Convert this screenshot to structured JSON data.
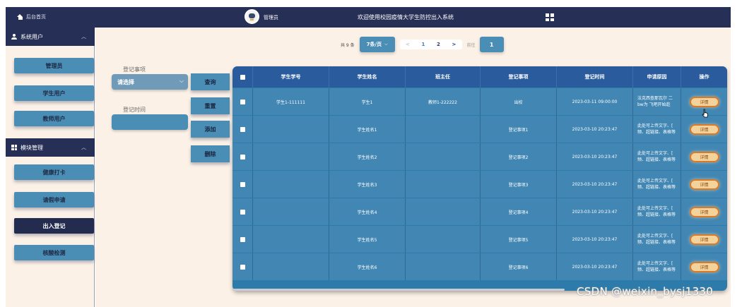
{
  "topbar": {
    "home_label": "后台首页",
    "role_label": "管理员",
    "title": "欢迎使用校园疫情大学生防控出入系统"
  },
  "sidebar": {
    "group1": {
      "label": "系统用户",
      "items": [
        "管理员",
        "学生用户",
        "教师用户"
      ]
    },
    "group2": {
      "label": "模块管理",
      "items": [
        "健康打卡",
        "请假申请",
        "出入登记",
        "核酸检测"
      ]
    },
    "active_item": "出入登记"
  },
  "pagination": {
    "total": "共 9 条",
    "page_size": "7条/页",
    "pages": [
      "1",
      "2"
    ],
    "current": "1",
    "goto_label": "前往",
    "goto_value": "1"
  },
  "filters": {
    "type_label": "登记事项",
    "type_value": "请选择",
    "time_label": "登记时间",
    "time_value": ""
  },
  "actions": {
    "search": "查询",
    "reset": "重置",
    "add": "添加",
    "delete": "删除"
  },
  "table": {
    "headers": [
      "学生学号",
      "学生姓名",
      "班主任",
      "登记事项",
      "登记时间",
      "申请原因",
      "操作"
    ],
    "rows": [
      {
        "student_no": "学生1-111111",
        "name": "学生1",
        "teacher": "教师1-222222",
        "item": "出校",
        "time": "2023-03-11 09:00:00",
        "reason": "法克西查那瓦尔 二\nbw为 飞吧开始趁",
        "op": "详情"
      },
      {
        "student_no": "",
        "name": "学生姓名1",
        "teacher": "",
        "item": "登记事项1",
        "time": "2023-03-10 20:23:47",
        "reason": "此处可上传文字、[\n频、超链接、表格等",
        "op": "详情"
      },
      {
        "student_no": "",
        "name": "学生姓名2",
        "teacher": "",
        "item": "登记事项2",
        "time": "2023-03-10 20:23:47",
        "reason": "此处可上传文字、[\n频、超链接、表格等",
        "op": "详情"
      },
      {
        "student_no": "",
        "name": "学生姓名3",
        "teacher": "",
        "item": "登记事项3",
        "time": "2023-03-10 20:23:47",
        "reason": "此处可上传文字、[\n频、超链接、表格等",
        "op": "详情"
      },
      {
        "student_no": "",
        "name": "学生姓名4",
        "teacher": "",
        "item": "登记事项4",
        "time": "2023-03-10 20:23:47",
        "reason": "此处可上传文字、[\n频、超链接、表格等",
        "op": "详情"
      },
      {
        "student_no": "",
        "name": "学生姓名5",
        "teacher": "",
        "item": "登记事项5",
        "time": "2023-03-10 20:23:47",
        "reason": "此处可上传文字、[\n频、超链接、表格等",
        "op": "详情"
      },
      {
        "student_no": "",
        "name": "学生姓名6",
        "teacher": "",
        "item": "登记事项6",
        "time": "2023-03-10 20:23:47",
        "reason": "此处可上传文字、[\n频、超链接、表格等",
        "op": "详情"
      }
    ]
  },
  "watermark": "CSDN @weixin_bysj1330",
  "colors": {
    "header_dark": "#262f55",
    "accent_blue": "#4a8db5",
    "page_bg": "#fbf1e7",
    "detail_orange": "#d9792a"
  }
}
